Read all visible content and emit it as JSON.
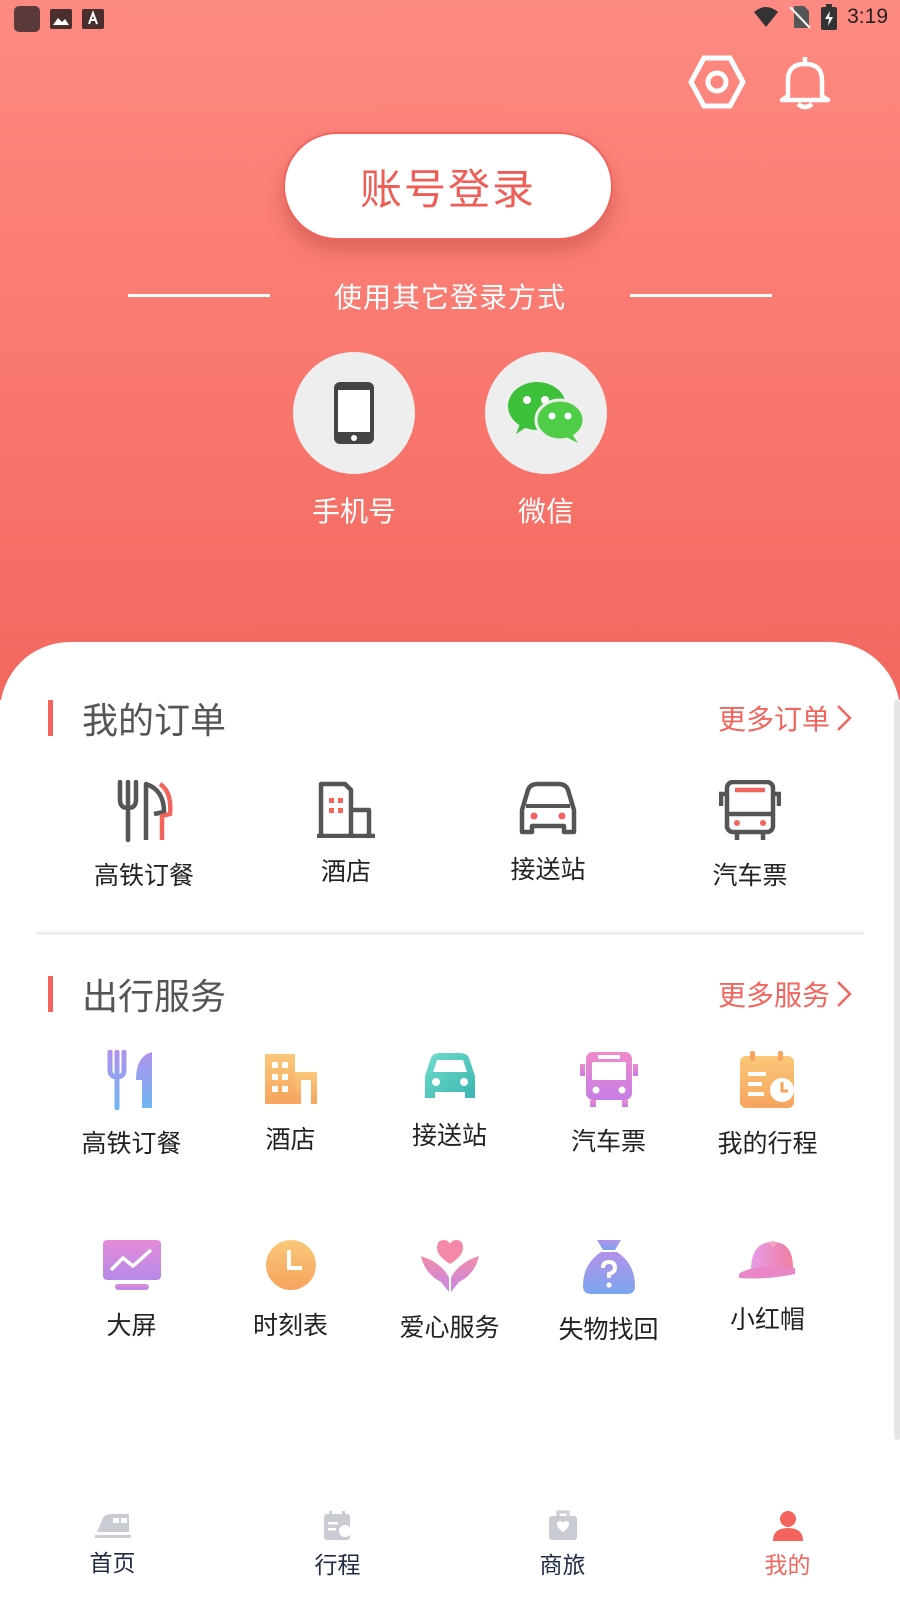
{
  "status_bar": {
    "time": "3:19"
  },
  "header": {
    "settings_icon": "settings-hex-icon",
    "notification_icon": "bell-icon"
  },
  "login": {
    "button_label": "账号登录",
    "other_methods_label": "使用其它登录方式",
    "methods": [
      {
        "label": "手机号",
        "icon": "phone-icon"
      },
      {
        "label": "微信",
        "icon": "wechat-icon"
      }
    ]
  },
  "orders": {
    "title": "我的订单",
    "more_label": "更多订单",
    "items": [
      {
        "label": "高铁订餐",
        "icon": "fork-knife-icon"
      },
      {
        "label": "酒店",
        "icon": "hotel-icon"
      },
      {
        "label": "接送站",
        "icon": "car-icon"
      },
      {
        "label": "汽车票",
        "icon": "bus-icon"
      }
    ]
  },
  "services": {
    "title": "出行服务",
    "more_label": "更多服务",
    "items": [
      {
        "label": "高铁订餐",
        "icon": "fork-knife-icon"
      },
      {
        "label": "酒店",
        "icon": "hotel-icon"
      },
      {
        "label": "接送站",
        "icon": "car-icon"
      },
      {
        "label": "汽车票",
        "icon": "bus-icon"
      },
      {
        "label": "我的行程",
        "icon": "itinerary-icon"
      },
      {
        "label": "大屏",
        "icon": "monitor-icon"
      },
      {
        "label": "时刻表",
        "icon": "clock-icon"
      },
      {
        "label": "爱心服务",
        "icon": "heart-hands-icon"
      },
      {
        "label": "失物找回",
        "icon": "lost-found-bag-icon"
      },
      {
        "label": "小红帽",
        "icon": "red-cap-icon"
      }
    ]
  },
  "tabbar": {
    "tabs": [
      {
        "label": "首页",
        "icon": "train-icon",
        "active": false
      },
      {
        "label": "行程",
        "icon": "itinerary-icon",
        "active": false
      },
      {
        "label": "商旅",
        "icon": "suitcase-icon",
        "active": false
      },
      {
        "label": "我的",
        "icon": "user-icon",
        "active": true
      }
    ]
  },
  "colors": {
    "brand": "#f3645d",
    "hero_top": "#fd8a82",
    "hero_bottom": "#f2685f",
    "text_dark": "#222222",
    "tab_text": "#1f2a44"
  }
}
